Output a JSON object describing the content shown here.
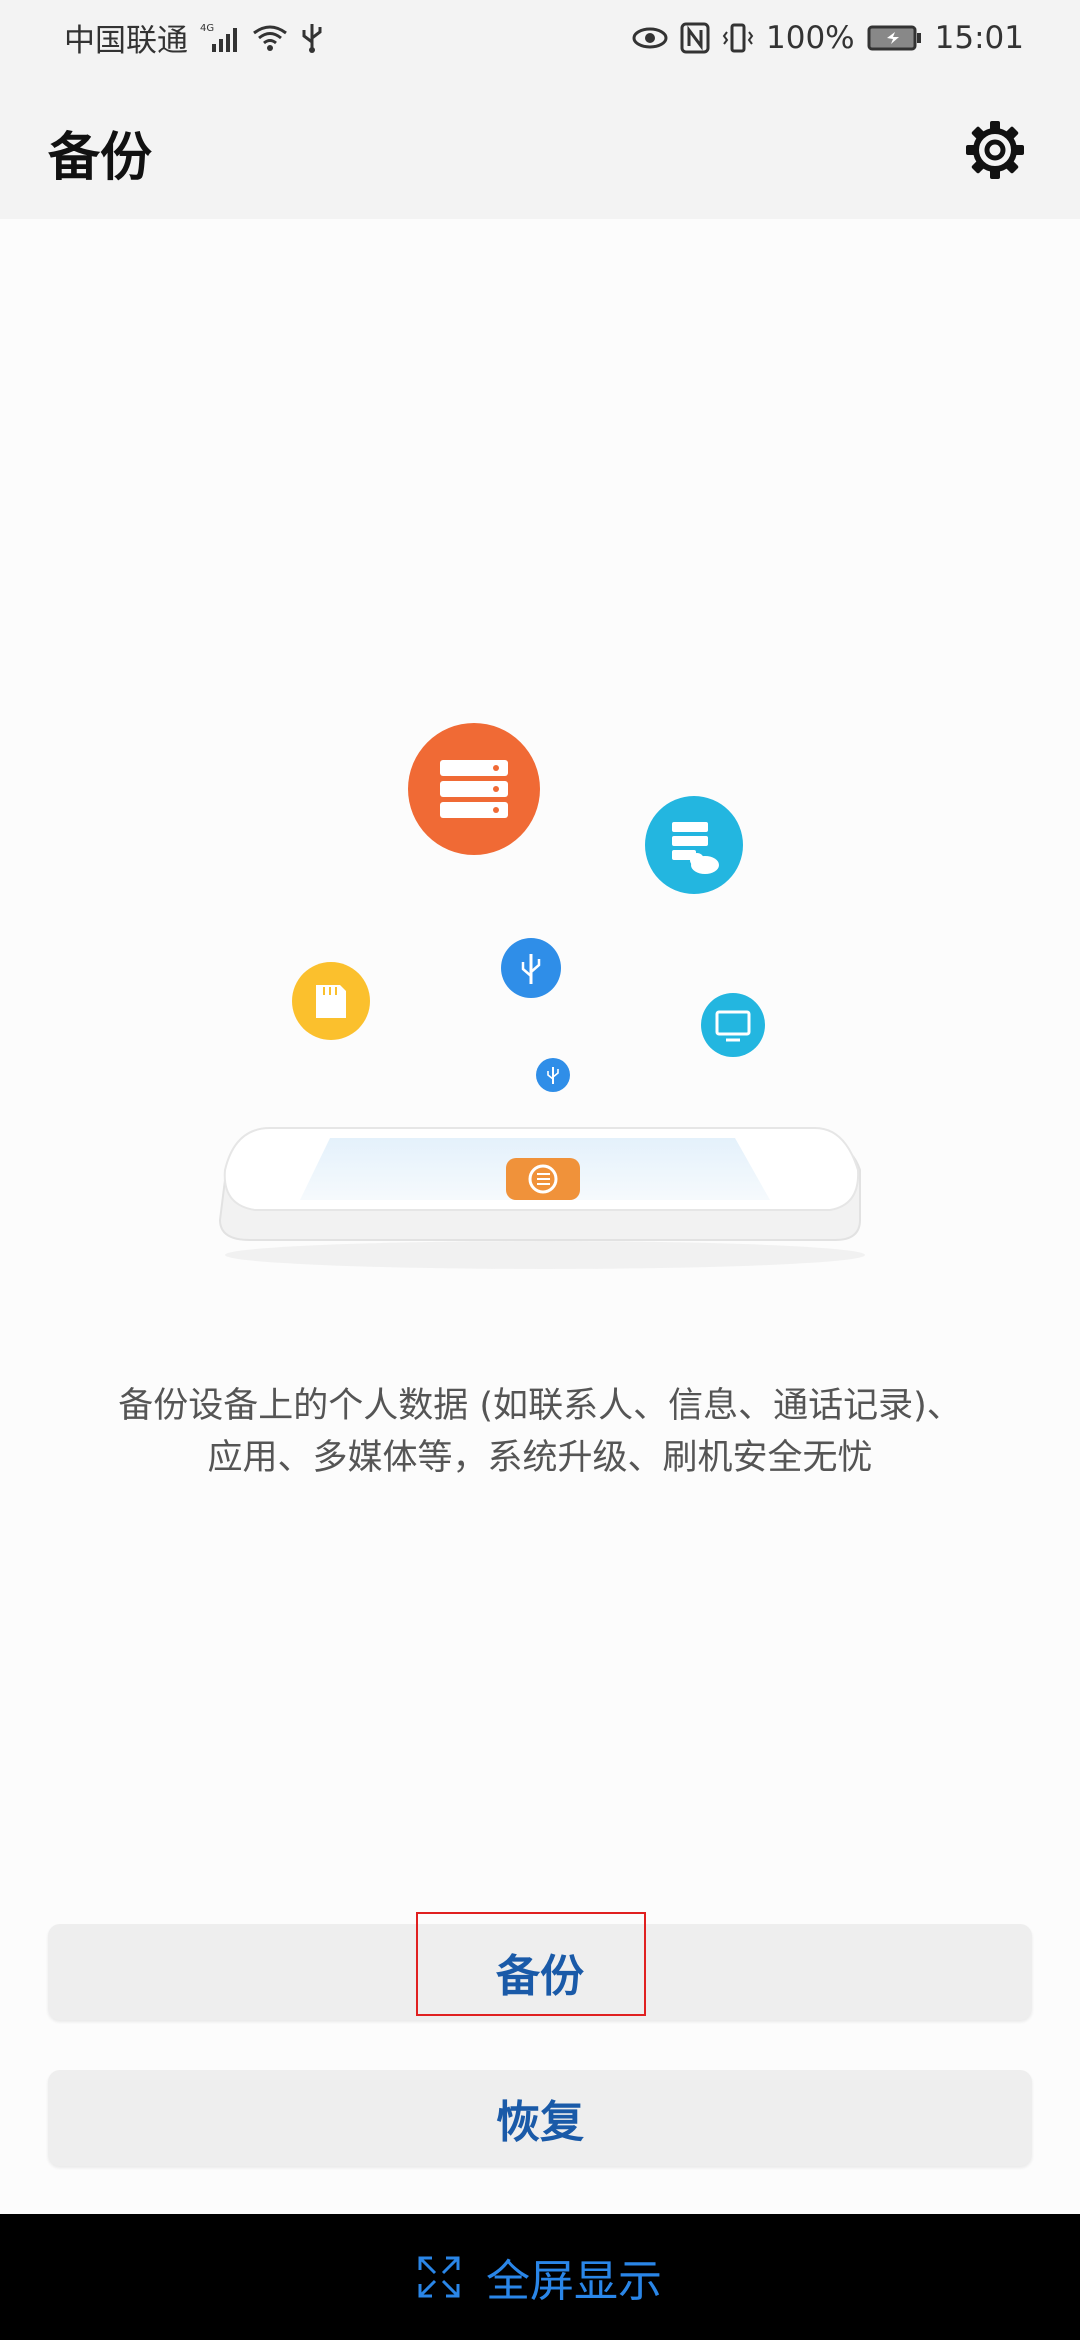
{
  "status_bar": {
    "carrier": "中国联通",
    "network_type": "4G",
    "battery": "100%",
    "time": "15:01",
    "icons": [
      "signal-icon",
      "wifi-icon",
      "usb-icon",
      "eye-icon",
      "nfc-icon",
      "vibrate-icon",
      "battery-icon"
    ]
  },
  "app_bar": {
    "title": "备份",
    "settings_icon": "gear-icon"
  },
  "illustration": {
    "icons": [
      "server-icon",
      "cloud-server-icon",
      "sd-card-icon",
      "usb-icon",
      "monitor-icon",
      "backup-app-icon"
    ],
    "colors": {
      "orange": "#f06a35",
      "cyan": "#23b6e0",
      "yellow": "#fbc02d",
      "blue": "#2f8ee8",
      "app_orange": "#f0923a"
    }
  },
  "description": {
    "line1": "备份设备上的个人数据 (如联系人、信息、通话记录)、",
    "line2": "应用、多媒体等，系统升级、刷机安全无忧"
  },
  "buttons": {
    "backup": "备份",
    "restore": "恢复"
  },
  "bottom_bar": {
    "fullscreen_label": "全屏显示",
    "icon": "expand-icon"
  },
  "colors": {
    "accent": "#1a5aa8",
    "highlight": "#e02020",
    "bottom_accent": "#2a86e8"
  }
}
